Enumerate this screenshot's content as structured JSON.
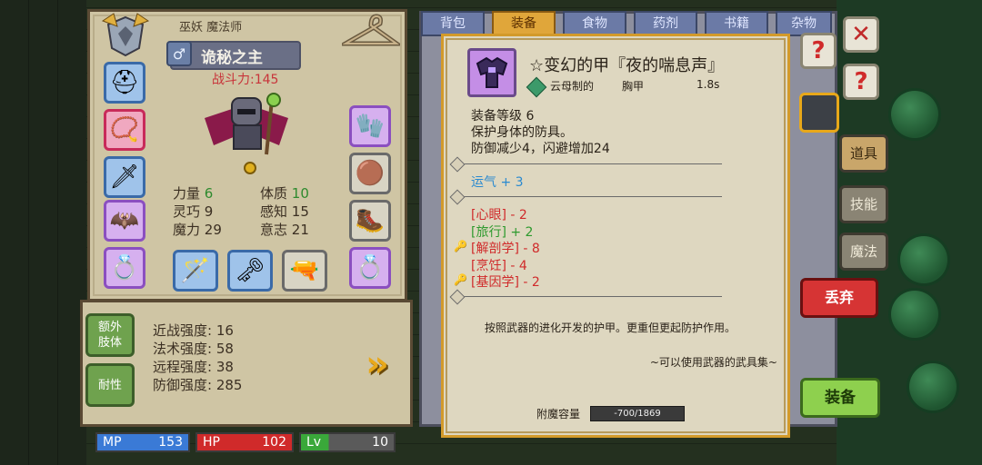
{
  "character": {
    "class_label": "巫妖 魔法师",
    "title": "诡秘之主",
    "gender_icon": "male-icon",
    "power": "战斗力:145",
    "stats": [
      {
        "name": "力量",
        "value": "6"
      },
      {
        "name": "体质",
        "value": "10"
      },
      {
        "name": "灵巧",
        "value": "9"
      },
      {
        "name": "感知",
        "value": "15"
      },
      {
        "name": "魔力",
        "value": "29"
      },
      {
        "name": "意志",
        "value": "21"
      }
    ]
  },
  "strengths": {
    "side_buttons": [
      "额外\n肢体",
      "耐性"
    ],
    "lines": [
      "近战强度: 16",
      "法术强度: 58",
      "远程强度: 38",
      "防御强度: 285"
    ]
  },
  "status_bars": {
    "mp": {
      "label": "MP",
      "value": "153"
    },
    "hp": {
      "label": "HP",
      "value": "102"
    },
    "lv": {
      "label": "Lv",
      "value": "10"
    }
  },
  "inventory_tabs": [
    "背包",
    "装备",
    "食物",
    "药剂",
    "书籍",
    "杂物"
  ],
  "right_tabs": [
    "道具",
    "技能",
    "魔法"
  ],
  "actions": {
    "drop": "丢弃",
    "equip": "装备"
  },
  "item": {
    "name": "☆变幻的甲『夜的喘息声』",
    "material": "云母制的",
    "slot": "胸甲",
    "weight": "1.8s",
    "level": "装备等级 6",
    "desc1": "保护身体的防具。",
    "desc2": "防御减少4，闪避增加24",
    "luck": "运气 + 3",
    "bonuses": [
      {
        "text": "[心眼] - 2",
        "color": "#d02a2a",
        "key": false
      },
      {
        "text": "[旅行] + 2",
        "color": "#2e9a2e",
        "key": false
      },
      {
        "text": "[解剖学] - 8",
        "color": "#d02a2a",
        "key": true
      },
      {
        "text": "[烹饪] - 4",
        "color": "#d02a2a",
        "key": false
      },
      {
        "text": "[基因学] - 2",
        "color": "#d02a2a",
        "key": true
      }
    ],
    "flavor": "按照武器的进化开发的护甲。更重但更起防护作用。",
    "source": "~可以使用武器的武具集~",
    "enchant_label": "附魔容量",
    "enchant_value": "-700/1869"
  }
}
